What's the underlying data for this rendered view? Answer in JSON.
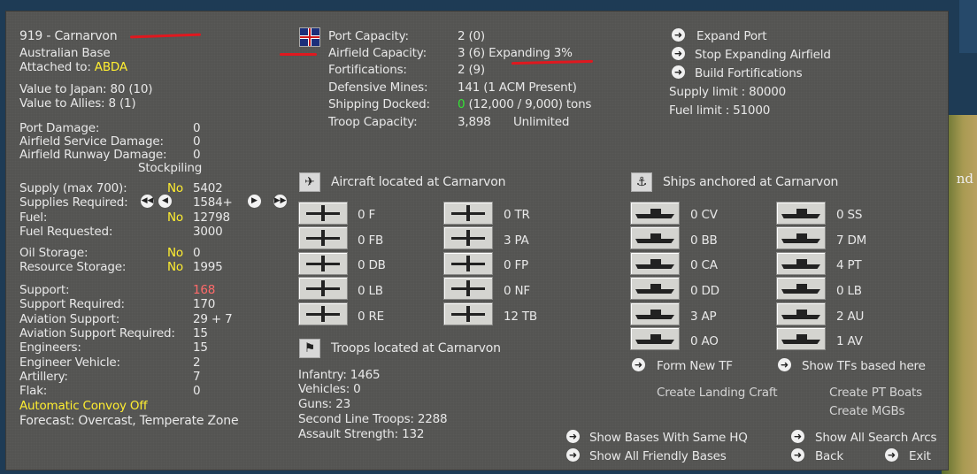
{
  "map": {
    "label": "nd"
  },
  "base": {
    "title": "919 - Carnarvon",
    "type": "Australian Base",
    "attached_label": "Attached to:",
    "attached_value": "ABDA",
    "value_japan": "Value to Japan: 80 (10)",
    "value_allies": "Value to Allies: 8 (1)"
  },
  "damage": {
    "port_label": "Port Damage:",
    "port_value": "0",
    "service_label": "Airfield Service Damage:",
    "service_value": "0",
    "runway_label": "Airfield Runway Damage:",
    "runway_value": "0",
    "stockpiling": "Stockpiling"
  },
  "supply": {
    "supply_label": "Supply (max 700):",
    "supply_flag": "No",
    "supply_value": "5402",
    "required_label": "Supplies Required:",
    "required_value": "1584+",
    "fuel_label": "Fuel:",
    "fuel_flag": "No",
    "fuel_value": "12798",
    "fuel_req_label": "Fuel Requested:",
    "fuel_req_value": "3000",
    "oil_label": "Oil Storage:",
    "oil_flag": "No",
    "oil_value": "0",
    "resource_label": "Resource Storage:",
    "resource_flag": "No",
    "resource_value": "1995"
  },
  "support": {
    "support_label": "Support:",
    "support_value": "168",
    "support_req_label": "Support Required:",
    "support_req_value": "170",
    "aviation_label": "Aviation Support:",
    "aviation_value": "29 + 7",
    "aviation_req_label": "Aviation Support Required:",
    "aviation_req_value": "15",
    "engineers_label": "Engineers:",
    "engineers_value": "15",
    "eng_vehicle_label": "Engineer Vehicle:",
    "eng_vehicle_value": "2",
    "artillery_label": "Artillery:",
    "artillery_value": "7",
    "flak_label": "Flak:",
    "flak_value": "0",
    "convoy": "Automatic Convoy Off",
    "forecast": "Forecast: Overcast, Temperate Zone"
  },
  "capacity": {
    "port_label": "Port Capacity:",
    "port_value": "2 (0)",
    "airfield_label": "Airfield Capacity:",
    "airfield_value": "3 (6) Expanding 3%",
    "fort_label": "Fortifications:",
    "fort_value": "2 (9)",
    "mines_label": "Defensive Mines:",
    "mines_value": "141 (1 ACM Present)",
    "shipping_label": "Shipping Docked:",
    "shipping_zero": "0",
    "shipping_value": "(12,000 / 9,000) tons",
    "troop_label": "Troop Capacity:",
    "troop_value": "3,898",
    "troop_extra": "Unlimited"
  },
  "actions": {
    "expand_port": "Expand Port",
    "stop_airfield": "Stop Expanding Airfield",
    "build_fort": "Build Fortifications",
    "supply_limit": "Supply limit : 80000",
    "fuel_limit": "Fuel limit : 51000"
  },
  "aircraft": {
    "title": "Aircraft located at Carnarvon",
    "left": [
      "0 F",
      "0 FB",
      "0 DB",
      "0 LB",
      "0 RE"
    ],
    "right": [
      "0 TR",
      "3 PA",
      "0 FP",
      "0 NF",
      "12 TB"
    ]
  },
  "ships": {
    "title": "Ships anchored at Carnarvon",
    "left": [
      "0 CV",
      "0 BB",
      "0 CA",
      "0 DD",
      "3 AP",
      "0 AO"
    ],
    "right": [
      "0 SS",
      "7 DM",
      "4 PT",
      "0 LB",
      "2 AU",
      "1 AV"
    ],
    "form_tf": "Form New TF",
    "show_tfs": "Show TFs based here",
    "landing": "Create Landing Craft",
    "pt_boats": "Create PT Boats",
    "mgbs": "Create MGBs"
  },
  "troops": {
    "title": "Troops located at Carnarvon",
    "infantry": "Infantry: 1465",
    "vehicles": "Vehicles: 0",
    "guns": "Guns: 23",
    "second_line": "Second Line Troops: 2288",
    "assault": "Assault Strength: 132"
  },
  "footer": {
    "same_hq": "Show Bases With Same HQ",
    "friendly": "Show All Friendly Bases",
    "search_arcs": "Show All Search Arcs",
    "back": "Back",
    "exit": "Exit"
  }
}
